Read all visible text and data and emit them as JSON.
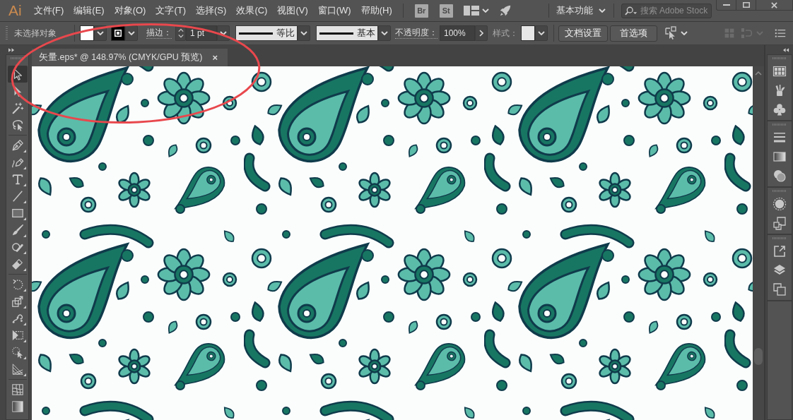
{
  "menu_bar": {
    "logo": "Ai",
    "menus": [
      "文件(F)",
      "编辑(E)",
      "对象(O)",
      "文字(T)",
      "选择(S)",
      "效果(C)",
      "视图(V)",
      "窗口(W)",
      "帮助(H)"
    ],
    "apps": [
      "Br",
      "St"
    ],
    "workspace": "基本功能",
    "search": {
      "placeholder": "搜索 Adobe Stock"
    }
  },
  "control_bar": {
    "selection": "未选择对象",
    "fill": {
      "color": "#ffffff"
    },
    "stroke": {
      "color": "#000000"
    },
    "stroke_label": "描边：",
    "stroke_weight": "1 pt",
    "stroke_profile": "等比",
    "brush": "基本",
    "opacity_label": "不透明度：",
    "opacity": "100%",
    "style_label": "样式：",
    "style": {
      "color": "#e6e6e6"
    },
    "buttons": [
      "文档设置",
      "首选项"
    ],
    "tools": [
      {
        "kind": "similar",
        "disabled": false
      },
      {
        "kind": "grid",
        "disabled": true
      },
      {
        "kind": "align",
        "disabled": true
      },
      {
        "kind": "menu",
        "disabled": false
      }
    ]
  },
  "tabs": [
    {
      "label": "矢量.eps* @ 148.97% (CMYK/GPU 预览)",
      "close": "×",
      "selected": true
    }
  ],
  "toolbar": {
    "groups": [
      {
        "tools": [
          {
            "kind": "select",
            "selected": true,
            "flyout": false
          },
          {
            "kind": "direct",
            "selected": false,
            "flyout": false
          },
          {
            "kind": "wand",
            "selected": false,
            "flyout": false
          },
          {
            "kind": "lasso",
            "selected": false,
            "flyout": false
          }
        ]
      },
      {
        "tools": [
          {
            "kind": "pen",
            "selected": false,
            "flyout": true
          },
          {
            "kind": "curvature",
            "selected": false,
            "flyout": true
          },
          {
            "kind": "type",
            "selected": false,
            "flyout": true
          },
          {
            "kind": "line",
            "selected": false,
            "flyout": true
          },
          {
            "kind": "rectangle",
            "selected": false,
            "flyout": true
          },
          {
            "kind": "brush",
            "selected": false,
            "flyout": true
          },
          {
            "kind": "shaper",
            "selected": false,
            "flyout": true
          },
          {
            "kind": "eraser",
            "selected": false,
            "flyout": true
          }
        ]
      },
      {
        "tools": [
          {
            "kind": "rotate",
            "selected": false,
            "flyout": true
          },
          {
            "kind": "scale",
            "selected": false,
            "flyout": true
          },
          {
            "kind": "puppet",
            "selected": false,
            "flyout": true
          },
          {
            "kind": "transform",
            "selected": false,
            "flyout": true
          },
          {
            "kind": "builder",
            "selected": false,
            "flyout": true
          },
          {
            "kind": "perspective",
            "selected": false,
            "flyout": true
          }
        ]
      },
      {
        "tools": [
          {
            "kind": "mesh",
            "selected": false,
            "flyout": false
          },
          {
            "kind": "gradient",
            "selected": false,
            "flyout": false
          }
        ]
      }
    ]
  },
  "dock": {
    "groups": [
      {
        "panels": [
          {
            "kind": "swatches"
          },
          {
            "kind": "brushes"
          },
          {
            "kind": "symbols"
          }
        ]
      },
      {
        "panels": [
          {
            "kind": "stroke"
          },
          {
            "kind": "gradient"
          },
          {
            "kind": "transparency"
          }
        ]
      },
      {
        "panels": [
          {
            "kind": "appearance"
          },
          {
            "kind": "styles"
          }
        ]
      },
      {
        "panels": [
          {
            "kind": "export"
          },
          {
            "kind": "layers"
          },
          {
            "kind": "artboards"
          }
        ]
      }
    ]
  },
  "annotations": [
    {
      "kind": "ellipse"
    }
  ]
}
